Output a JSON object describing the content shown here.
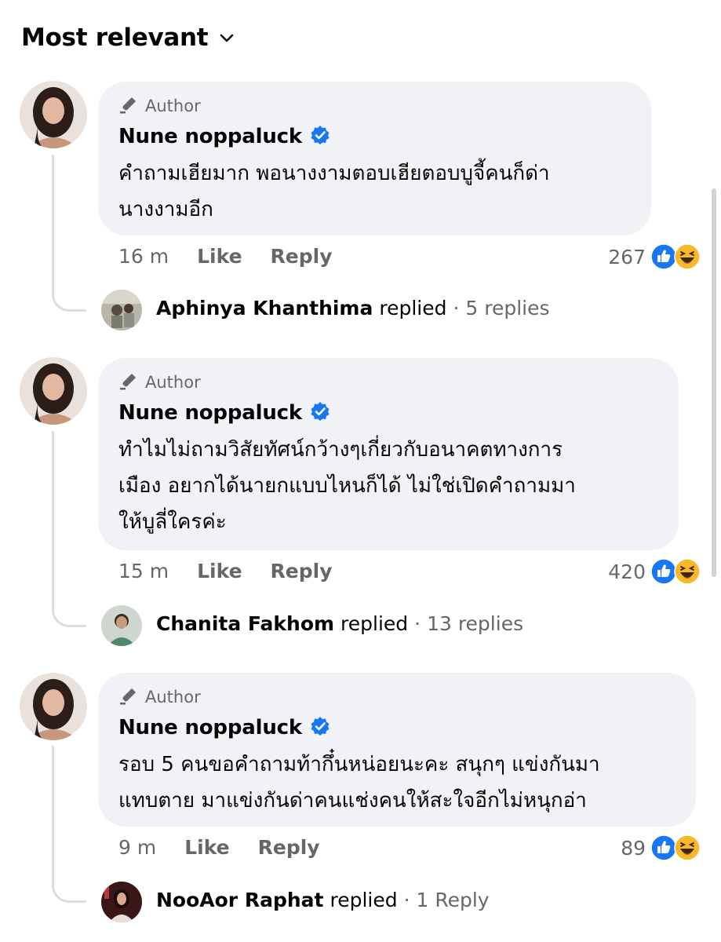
{
  "sort": {
    "label": "Most relevant"
  },
  "colors": {
    "accent": "#1877f2",
    "bubble": "#f0f2f5",
    "secondary_text": "#65676b"
  },
  "comments": [
    {
      "author_tag": "Author",
      "name": "Nune noppaluck",
      "text": "คำถามเฮียมาก พอนางงามตอบเฮียตอบบูจี้คนก็ด่า\nนางงามอีก",
      "time": "16 m",
      "like": "Like",
      "reply": "Reply",
      "reaction_count": "267",
      "reply_summary": {
        "name": "Aphinya Khanthima",
        "verb": "replied",
        "count": "· 5 replies"
      }
    },
    {
      "author_tag": "Author",
      "name": "Nune noppaluck",
      "text": "ทำไมไม่ถามวิสัยทัศน์กว้างๆเกี่ยวกับอนาคตทางการ\nเมือง อยากได้นายกแบบไหนก็ได้ ไม่ใช่เปิดคำถามมา\nให้บูลี่ใครค่ะ",
      "time": "15 m",
      "like": "Like",
      "reply": "Reply",
      "reaction_count": "420",
      "reply_summary": {
        "name": "Chanita Fakhom",
        "verb": "replied",
        "count": "· 13 replies"
      }
    },
    {
      "author_tag": "Author",
      "name": "Nune noppaluck",
      "text": "รอบ 5 คนขอคำถามท้ากึ๋นหน่อยนะคะ สนุกๆ แข่งกันมา\nแทบตาย มาแข่งกันด่าคนแช่งคนให้สะใจอีกไม่หนุกอ่า",
      "time": "9 m",
      "like": "Like",
      "reply": "Reply",
      "reaction_count": "89",
      "reply_summary": {
        "name": "NooAor Raphat",
        "verb": "replied",
        "count": "· 1 Reply"
      }
    }
  ]
}
